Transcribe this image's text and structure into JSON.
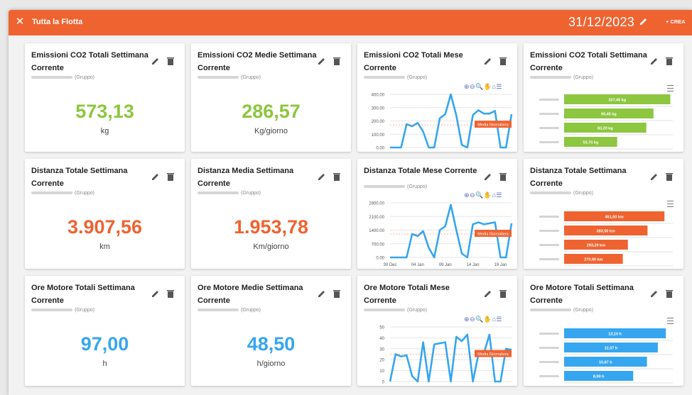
{
  "topbar": {
    "close_icon": "close-icon",
    "title": "Tutta la Flotta",
    "date": "31/12/2023",
    "create_label": "+ CREA",
    "color": "#ef6331"
  },
  "colors": {
    "green": "#8dc63f",
    "orange": "#ef6331",
    "blue": "#36a6f0"
  },
  "cards": {
    "c1": {
      "title": "Emissioni CO2 Totali Settimana Corrente",
      "group": "(Gruppo)",
      "value": "573,13",
      "unit": "kg"
    },
    "c2": {
      "title": "Emissioni CO2 Medie Settimana Corrente",
      "group": "(Gruppo)",
      "value": "286,57",
      "unit": "Kg/giorno"
    },
    "c3": {
      "title": "Emissioni CO2 Totali Mese Corrente",
      "group": "(Gruppo)"
    },
    "c4": {
      "title": "Emissioni CO2 Totali Settimana Corrente",
      "group": "(Gruppo)"
    },
    "c5": {
      "title": "Distanza Totale Settimana Corrente",
      "group": "(Gruppo)",
      "value": "3.907,56",
      "unit": "km"
    },
    "c6": {
      "title": "Distanza Media Settimana Corrente",
      "group": "(Gruppo)",
      "value": "1.953,78",
      "unit": "Km/giorno"
    },
    "c7": {
      "title": "Distanza Totale Mese Corrente",
      "group": "(Gruppo)"
    },
    "c8": {
      "title": "Distanza Totale Settimana Corrente",
      "group": "(Gruppo)"
    },
    "c9": {
      "title": "Ore Motore Totali Settimana Corrente",
      "group": "(Gruppo)",
      "value": "97,00",
      "unit": "h"
    },
    "c10": {
      "title": "Ore Motore Medie Settimana Corrente",
      "group": "(Gruppo)",
      "value": "48,50",
      "unit": "h/giorno"
    },
    "c11": {
      "title": "Ore Motore Totali Mese Corrente",
      "group": "(Gruppo)"
    },
    "c12": {
      "title": "Ore Motore Totali Settimana Corrente",
      "group": "(Gruppo)"
    }
  },
  "chart_data": [
    {
      "type": "line",
      "color": "#36a6f0",
      "y_ticks": [
        "400.00",
        "300.00",
        "200.00",
        "100.00",
        "0.00"
      ],
      "ylim": [
        0,
        400
      ],
      "values": [
        0,
        0,
        0,
        175,
        160,
        185,
        120,
        0,
        0,
        220,
        250,
        400,
        240,
        20,
        0,
        245,
        280,
        255,
        255,
        275,
        0,
        0,
        250
      ],
      "annotation": "Media Giornaliera",
      "annotation_value": 170
    },
    {
      "type": "hbar",
      "color": "#8dc63f",
      "labels": [
        "107,46 kg",
        "90,45 kg",
        "83,20 kg",
        "53,70 kg"
      ],
      "values": [
        107.46,
        90.45,
        83.2,
        53.7
      ],
      "xlim": [
        0,
        110
      ]
    },
    {
      "type": "line",
      "color": "#36a6f0",
      "y_ticks": [
        "2800.00",
        "2100.00",
        "1400.00",
        "700.00",
        "0.00"
      ],
      "ylim": [
        0,
        2800
      ],
      "x_ticks": [
        "30 Dec",
        "04 Jan",
        "09 Jan",
        "14 Jan",
        "19 Jan"
      ],
      "values": [
        0,
        0,
        0,
        0,
        1200,
        1100,
        1350,
        500,
        0,
        1400,
        1600,
        2700,
        1400,
        200,
        0,
        1700,
        1800,
        1700,
        1750,
        1800,
        0,
        0,
        1750
      ],
      "annotation": "Media Giornaliera",
      "annotation_value": 1200
    },
    {
      "type": "hbar",
      "color": "#ef6331",
      "labels": [
        "461,50 km",
        "383,50 km",
        "293,29 km",
        "270,00 km"
      ],
      "values": [
        461.5,
        383.5,
        293.29,
        270.0
      ],
      "xlim": [
        0,
        500
      ]
    },
    {
      "type": "line",
      "color": "#36a6f0",
      "y_ticks": [
        "50",
        "40",
        "30",
        "20",
        "10",
        "0"
      ],
      "ylim": [
        0,
        50
      ],
      "values": [
        0,
        25,
        23,
        24,
        5,
        0,
        36,
        0,
        34,
        35,
        36,
        0,
        41,
        37,
        43,
        0,
        25,
        26,
        43,
        0,
        0,
        30,
        29
      ],
      "annotation": "Media Giornaliera",
      "annotation_value": 25
    },
    {
      "type": "hbar",
      "color": "#36a6f0",
      "labels": [
        "13,10 h",
        "12,07 h",
        "10,67 h",
        "8,90 h"
      ],
      "values": [
        13.1,
        12.07,
        10.67,
        8.9
      ],
      "xlim": [
        0,
        14
      ]
    }
  ]
}
